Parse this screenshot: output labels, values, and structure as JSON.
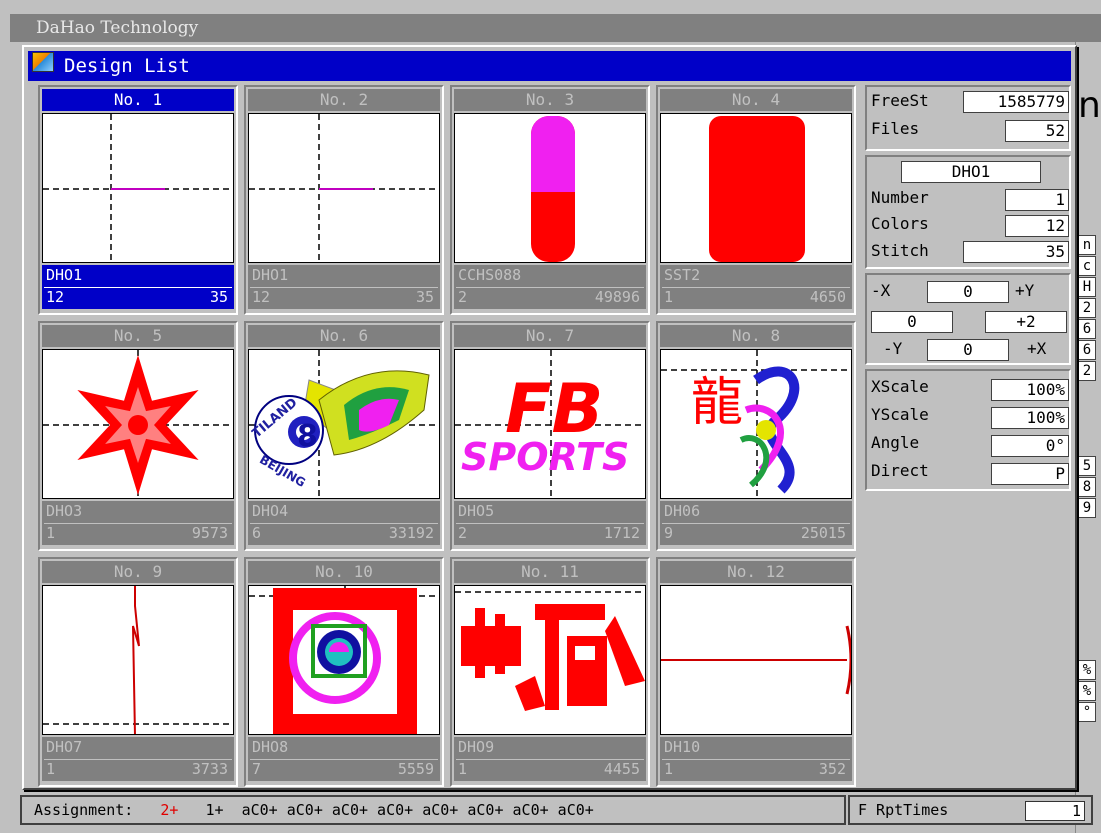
{
  "app": {
    "title": "DaHao Technology",
    "big_letter": "n",
    "side_letters": [
      "n",
      "c",
      "H",
      "2",
      "6",
      "6",
      "2",
      "5",
      "8",
      "9",
      "%",
      "%",
      "°"
    ]
  },
  "background_bar": {
    "label": "Assignment:",
    "red": "2+",
    "rest": "1+  aC0+ aC0+ aC0+ aC0+ aC0+ aC0+ aC0+ aC0+",
    "right_label": "F RptTimes",
    "right_value": "1"
  },
  "dialog": {
    "title": "Design List"
  },
  "designs": [
    {
      "no": "No. 1",
      "name": "DHO1",
      "colors": "12",
      "stitch": "35"
    },
    {
      "no": "No. 2",
      "name": "DHO1",
      "colors": "12",
      "stitch": "35"
    },
    {
      "no": "No. 3",
      "name": "CCHS088",
      "colors": "2",
      "stitch": "49896"
    },
    {
      "no": "No. 4",
      "name": "SST2",
      "colors": "1",
      "stitch": "4650"
    },
    {
      "no": "No. 5",
      "name": "DHO3",
      "colors": "1",
      "stitch": "9573"
    },
    {
      "no": "No. 6",
      "name": "DHO4",
      "colors": "6",
      "stitch": "33192"
    },
    {
      "no": "No. 7",
      "name": "DHO5",
      "colors": "2",
      "stitch": "1712"
    },
    {
      "no": "No. 8",
      "name": "DH06",
      "colors": "9",
      "stitch": "25015"
    },
    {
      "no": "No. 9",
      "name": "DHO7",
      "colors": "1",
      "stitch": "3733"
    },
    {
      "no": "No. 10",
      "name": "DHO8",
      "colors": "7",
      "stitch": "5559"
    },
    {
      "no": "No. 11",
      "name": "DHO9",
      "colors": "1",
      "stitch": "4455"
    },
    {
      "no": "No. 12",
      "name": "DH10",
      "colors": "1",
      "stitch": "352"
    }
  ],
  "panel": {
    "freest_label": "FreeSt",
    "freest_value": "1585779",
    "files_label": "Files",
    "files_value": "52",
    "design_name": "DHO1",
    "number_label": "Number",
    "number_value": "1",
    "colors_label": "Colors",
    "colors_value": "12",
    "stitch_label": "Stitch",
    "stitch_value": "35",
    "minus_x": "-X",
    "minus_x_val": "0",
    "plus_y": "+Y",
    "mid_left_val": "0",
    "mid_right_val": "+2",
    "minus_y": "-Y",
    "minus_y_val": "0",
    "plus_x": "+X",
    "xscale_label": "XScale",
    "xscale_value": "100%",
    "yscale_label": "YScale",
    "yscale_value": "100%",
    "angle_label": "Angle",
    "angle_value": "0°",
    "direct_label": "Direct",
    "direct_value": "P"
  },
  "preview_texts": {
    "fb": "FB",
    "sports": "SPORTS",
    "tiland": "TILAND",
    "eight": "8",
    "beijing": "BEIJING",
    "dragon": "龍"
  },
  "colors": {
    "title_blue": "#0000c8",
    "panel_gray": "#c0c0c0",
    "header_gray": "#808080",
    "stitch_red": "#ff0000",
    "magenta": "#ff00ff"
  }
}
